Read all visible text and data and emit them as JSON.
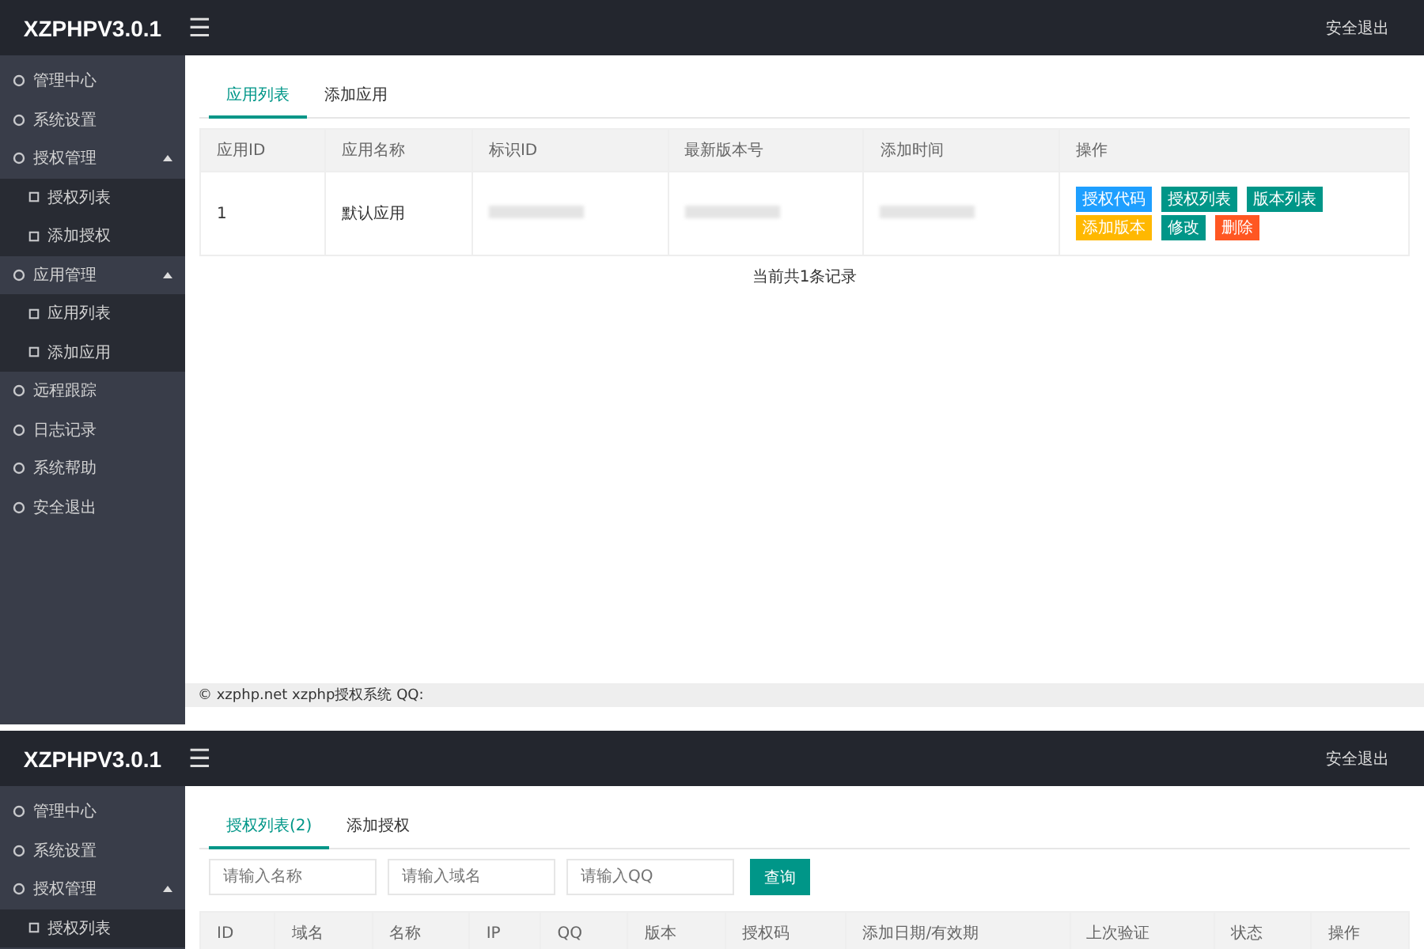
{
  "screens": [
    {
      "kind": "app_list",
      "header": {
        "logo": "XZPHPV3.0.1",
        "menu_icon": "☰",
        "logout": "安全退出"
      },
      "sidebar": {
        "items": [
          {
            "label": "管理中心"
          },
          {
            "label": "系统设置"
          },
          {
            "label": "授权管理",
            "expanded": true,
            "children": [
              {
                "label": "授权列表"
              },
              {
                "label": "添加授权"
              }
            ]
          },
          {
            "label": "应用管理",
            "expanded": true,
            "children": [
              {
                "label": "应用列表"
              },
              {
                "label": "添加应用"
              }
            ]
          },
          {
            "label": "远程跟踪"
          },
          {
            "label": "日志记录"
          },
          {
            "label": "系统帮助"
          },
          {
            "label": "安全退出"
          }
        ]
      },
      "tabs": [
        {
          "label": "应用列表",
          "selected": true
        },
        {
          "label": "添加应用",
          "selected": false
        }
      ],
      "table": {
        "columns": [
          "应用ID",
          "应用名称",
          "标识ID",
          "最新版本号",
          "添加时间",
          "操作"
        ],
        "rows": [
          {
            "cells": [
              {
                "text": "1"
              },
              {
                "text": "默认应用"
              },
              {
                "kind": "redacted"
              },
              {
                "kind": "redacted"
              },
              {
                "kind": "redacted"
              }
            ],
            "actions": [
              {
                "label": "授权代码",
                "color": "#1e9fff"
              },
              {
                "label": "授权列表",
                "color": "#009688"
              },
              {
                "label": "版本列表",
                "color": "#009688"
              },
              {
                "label": "添加版本",
                "color": "#ffb800"
              },
              {
                "label": "修改",
                "color": "#009688"
              },
              {
                "label": "删除",
                "color": "#ff5722"
              }
            ]
          }
        ]
      },
      "record_count": "当前共1条记录",
      "footer": "© xzphp.net xzphp授权系统 QQ:"
    },
    {
      "kind": "license_list",
      "header": {
        "logo": "XZPHPV3.0.1",
        "menu_icon": "☰",
        "logout": "安全退出"
      },
      "sidebar": {
        "items": [
          {
            "label": "管理中心"
          },
          {
            "label": "系统设置"
          },
          {
            "label": "授权管理",
            "expanded": true,
            "children": [
              {
                "label": "授权列表"
              }
            ]
          }
        ]
      },
      "tabs": [
        {
          "label": "授权列表(2)",
          "selected": true
        },
        {
          "label": "添加授权",
          "selected": false
        }
      ],
      "search": {
        "fields": [
          {
            "placeholder": "请输入名称"
          },
          {
            "placeholder": "请输入域名"
          },
          {
            "placeholder": "请输入QQ"
          }
        ],
        "button": "查询"
      },
      "table": {
        "columns": [
          "ID",
          "域名",
          "名称",
          "IP",
          "QQ",
          "版本",
          "授权码",
          "添加日期/有效期",
          "上次验证",
          "状态",
          "操作"
        ]
      }
    }
  ]
}
